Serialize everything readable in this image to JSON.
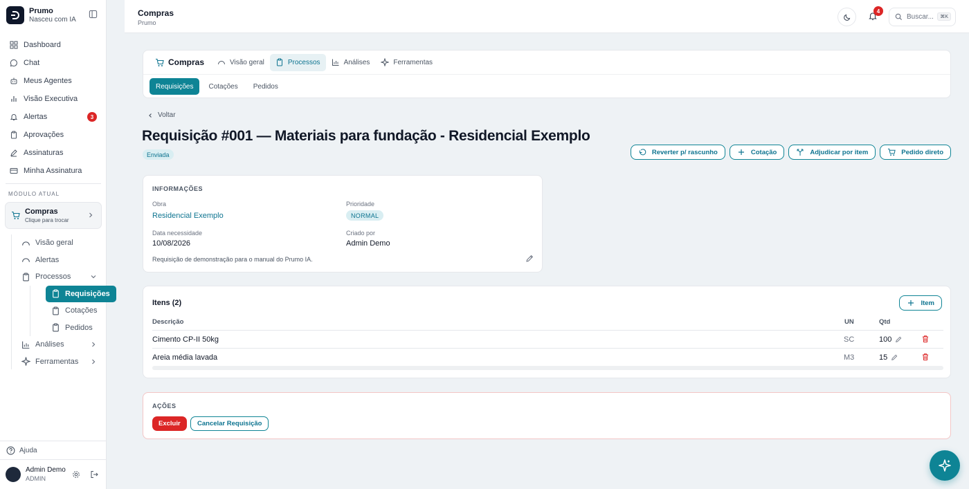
{
  "brand": {
    "name": "Prumo",
    "tagline": "Nasceu com IA",
    "logo_letter": "Ↄ"
  },
  "sidebar": {
    "items": [
      {
        "label": "Dashboard",
        "icon": "grid-icon"
      },
      {
        "label": "Chat",
        "icon": "chat-icon"
      },
      {
        "label": "Meus Agentes",
        "icon": "bot-icon"
      },
      {
        "label": "Visão Executiva",
        "icon": "bar-chart-icon"
      },
      {
        "label": "Alertas",
        "icon": "bell-icon",
        "badge": "3"
      },
      {
        "label": "Aprovações",
        "icon": "clipboard-icon"
      },
      {
        "label": "Assinaturas",
        "icon": "pen-icon"
      },
      {
        "label": "Minha Assinatura",
        "icon": "card-icon"
      }
    ],
    "section_label": "MÓDULO ATUAL",
    "module": {
      "name": "Compras",
      "hint": "Clique para trocar"
    },
    "subnav": {
      "visao_geral": "Visão geral",
      "alertas": "Alertas",
      "processos": "Processos",
      "children": [
        "Requisições",
        "Cotações",
        "Pedidos"
      ],
      "analises": "Análises",
      "ferramentas": "Ferramentas"
    },
    "help": "Ajuda",
    "user": {
      "name": "Admin Demo",
      "role": "ADMIN"
    }
  },
  "topbar": {
    "title": "Compras",
    "subtitle": "Prumo",
    "notifications": "4",
    "search_placeholder": "Buscar...",
    "search_shortcut": "⌘K"
  },
  "tabs": {
    "module": "Compras",
    "items": [
      "Visão geral",
      "Processos",
      "Análises",
      "Ferramentas"
    ],
    "active": "Processos",
    "subtabs": [
      "Requisições",
      "Cotações",
      "Pedidos"
    ],
    "active_subtab": "Requisições"
  },
  "page": {
    "back": "Voltar",
    "title": "Requisição #001 — Materiais para fundação - Residencial Exemplo",
    "status": "Enviada",
    "actions": [
      "Reverter p/ rascunho",
      "Cotação",
      "Adjudicar por item",
      "Pedido direto"
    ]
  },
  "info": {
    "heading": "INFORMAÇÕES",
    "obra_label": "Obra",
    "obra_value": "Residencial Exemplo",
    "prioridade_label": "Prioridade",
    "prioridade_value": "NORMAL",
    "data_label": "Data necessidade",
    "data_value": "10/08/2026",
    "criado_label": "Criado por",
    "criado_value": "Admin Demo",
    "note": "Requisição de demonstração para o manual do Prumo IA."
  },
  "items": {
    "title": "Itens (2)",
    "add_label": "Item",
    "columns": {
      "descricao": "Descrição",
      "un": "UN",
      "qtd": "Qtd"
    },
    "rows": [
      {
        "descricao": "Cimento CP-II 50kg",
        "un": "SC",
        "qtd": "100"
      },
      {
        "descricao": "Areia média lavada",
        "un": "M3",
        "qtd": "15"
      }
    ]
  },
  "actions": {
    "heading": "AÇÕES",
    "delete": "Excluir",
    "cancel": "Cancelar Requisição"
  },
  "colors": {
    "accent": "#0e8495",
    "danger": "#dc2626"
  }
}
